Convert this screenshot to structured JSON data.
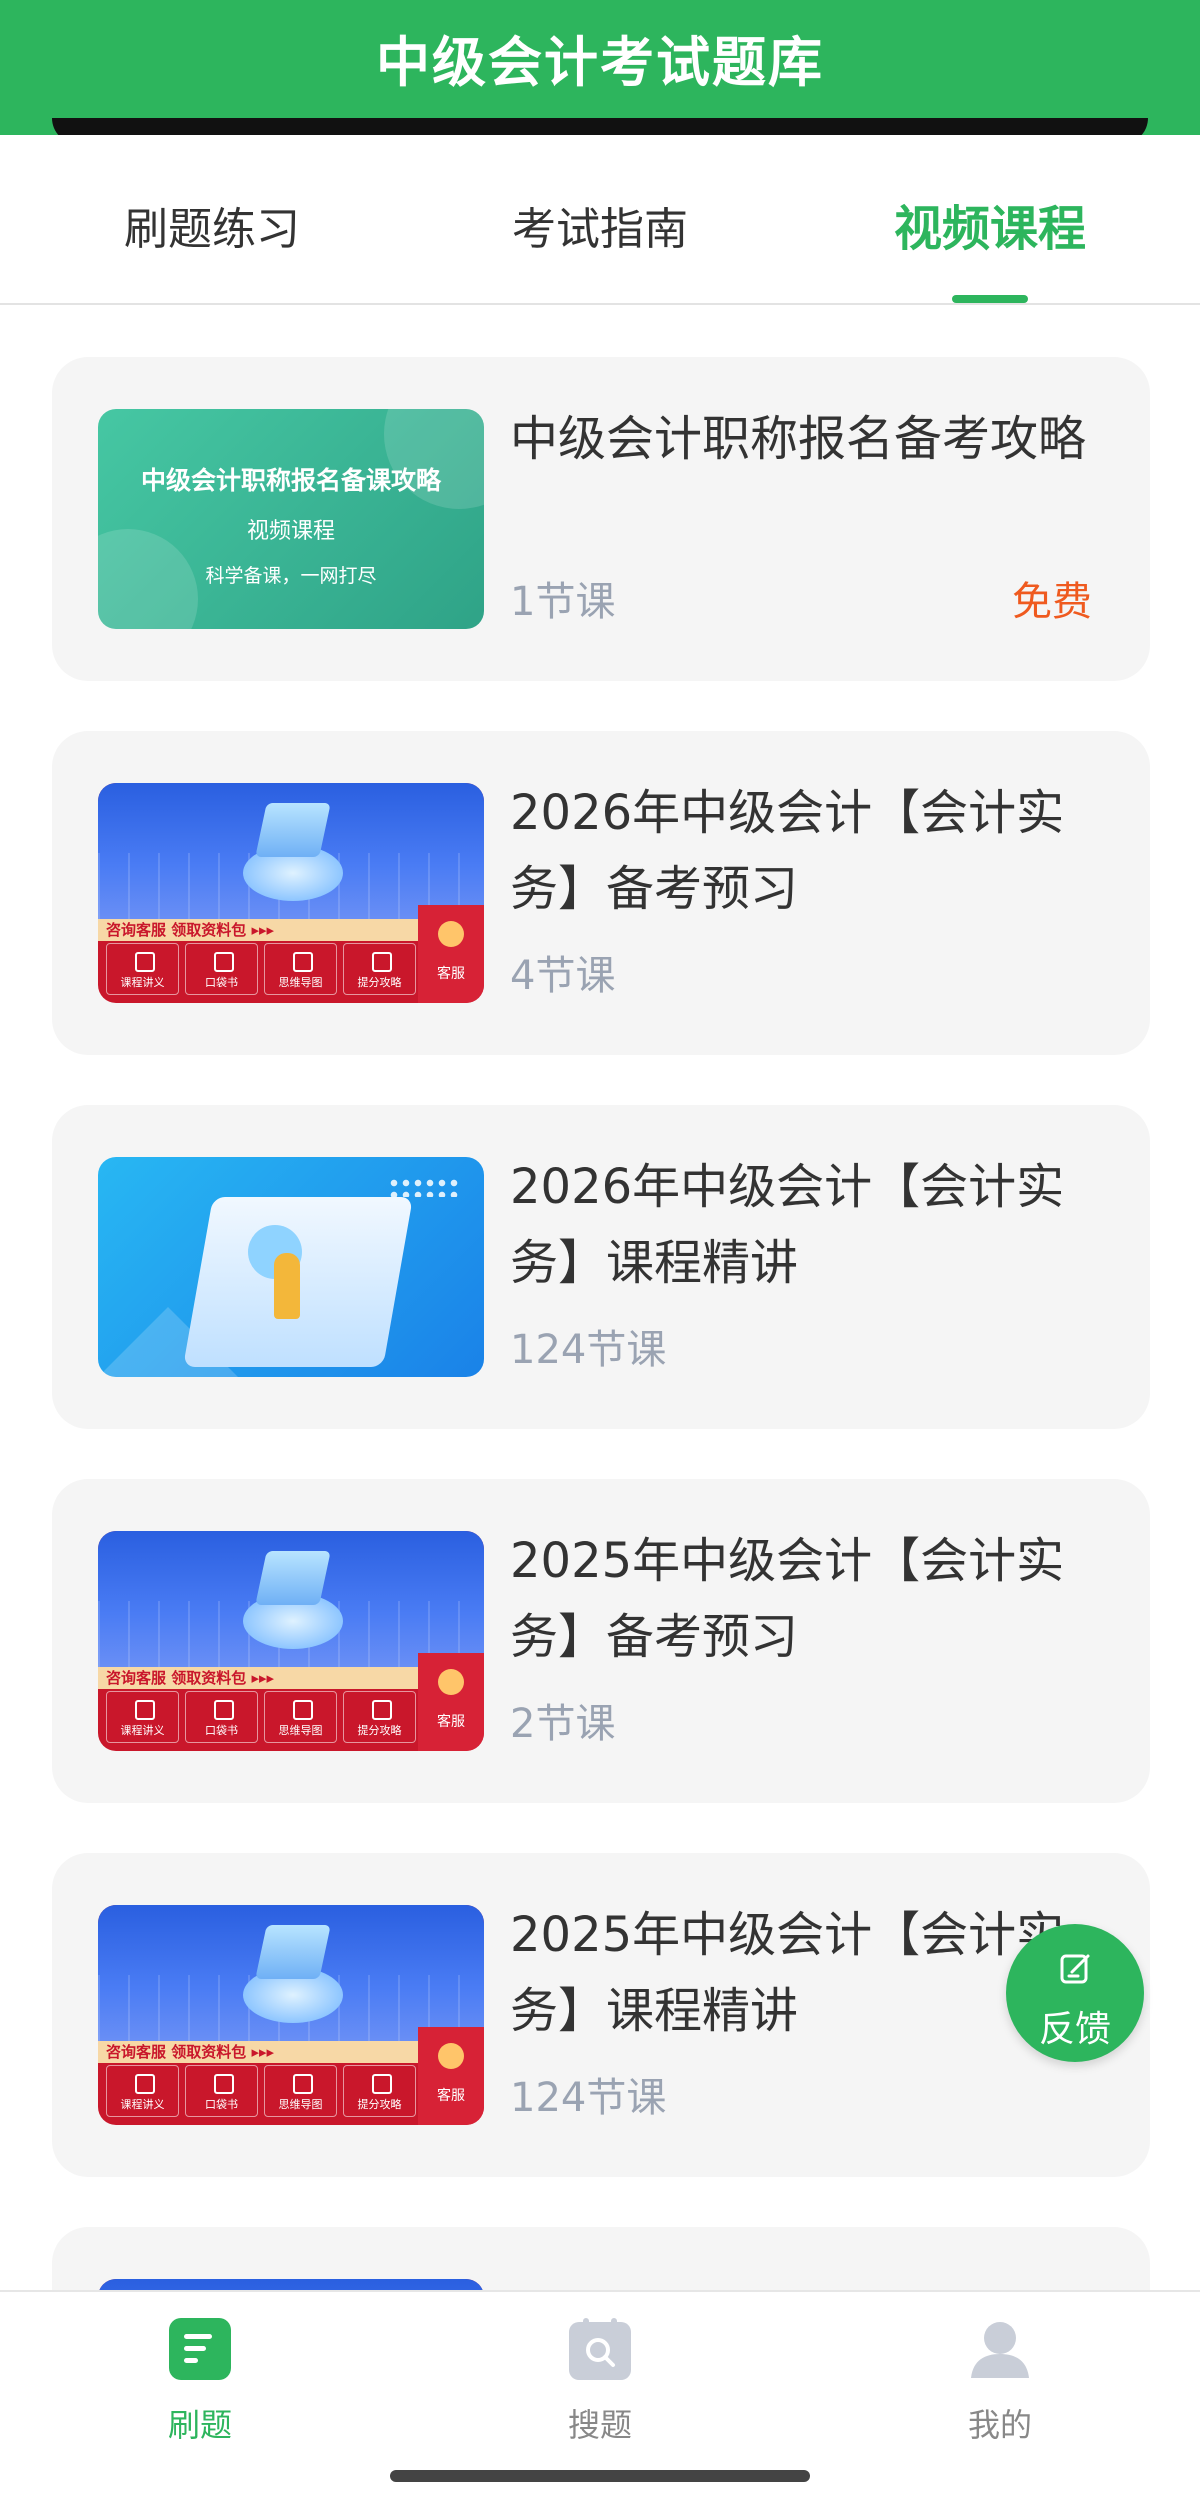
{
  "header": {
    "title": "中级会计考试题库"
  },
  "tabs": [
    {
      "label": "刷题练习",
      "active": false
    },
    {
      "label": "考试指南",
      "active": false
    },
    {
      "label": "视频课程",
      "active": true
    }
  ],
  "courses": [
    {
      "title": "中级会计职称报名备考攻略",
      "count": "1节课",
      "price": "免费",
      "thumb": {
        "type": "green",
        "line1": "中级会计职称报名备课攻略",
        "line2": "视频课程",
        "line3": "科学备课，一网打尽"
      }
    },
    {
      "title": "2026年中级会计【会计实务】备考预习",
      "count": "4节课",
      "thumb": {
        "type": "red",
        "strip": "咨询客服  领取资料包 ▸▸▸",
        "buttons": [
          "课程讲义",
          "口袋书",
          "思维导图",
          "提分攻略"
        ],
        "service": "客服"
      }
    },
    {
      "title": "2026年中级会计【会计实务】课程精讲",
      "count": "124节课",
      "thumb": {
        "type": "blue"
      }
    },
    {
      "title": "2025年中级会计【会计实务】备考预习",
      "count": "2节课",
      "thumb": {
        "type": "red",
        "strip": "咨询客服  领取资料包 ▸▸▸",
        "buttons": [
          "课程讲义",
          "口袋书",
          "思维导图",
          "提分攻略"
        ],
        "service": "客服"
      }
    },
    {
      "title": "2025年中级会计【会计实务】课程精讲",
      "count": "124节课",
      "thumb": {
        "type": "red",
        "strip": "咨询客服  领取资料包 ▸▸▸",
        "buttons": [
          "课程讲义",
          "口袋书",
          "思维导图",
          "提分攻略"
        ],
        "service": "客服"
      }
    }
  ],
  "feedback": {
    "label": "反馈",
    "icon": "edit-icon"
  },
  "bottom_nav": [
    {
      "label": "刷题",
      "icon": "document-icon",
      "active": true
    },
    {
      "label": "搜题",
      "icon": "search-icon",
      "active": false
    },
    {
      "label": "我的",
      "icon": "user-icon",
      "active": false
    }
  ],
  "colors": {
    "brand": "#2db55d",
    "price": "#ef5a1f",
    "muted": "#9aa3b2"
  }
}
